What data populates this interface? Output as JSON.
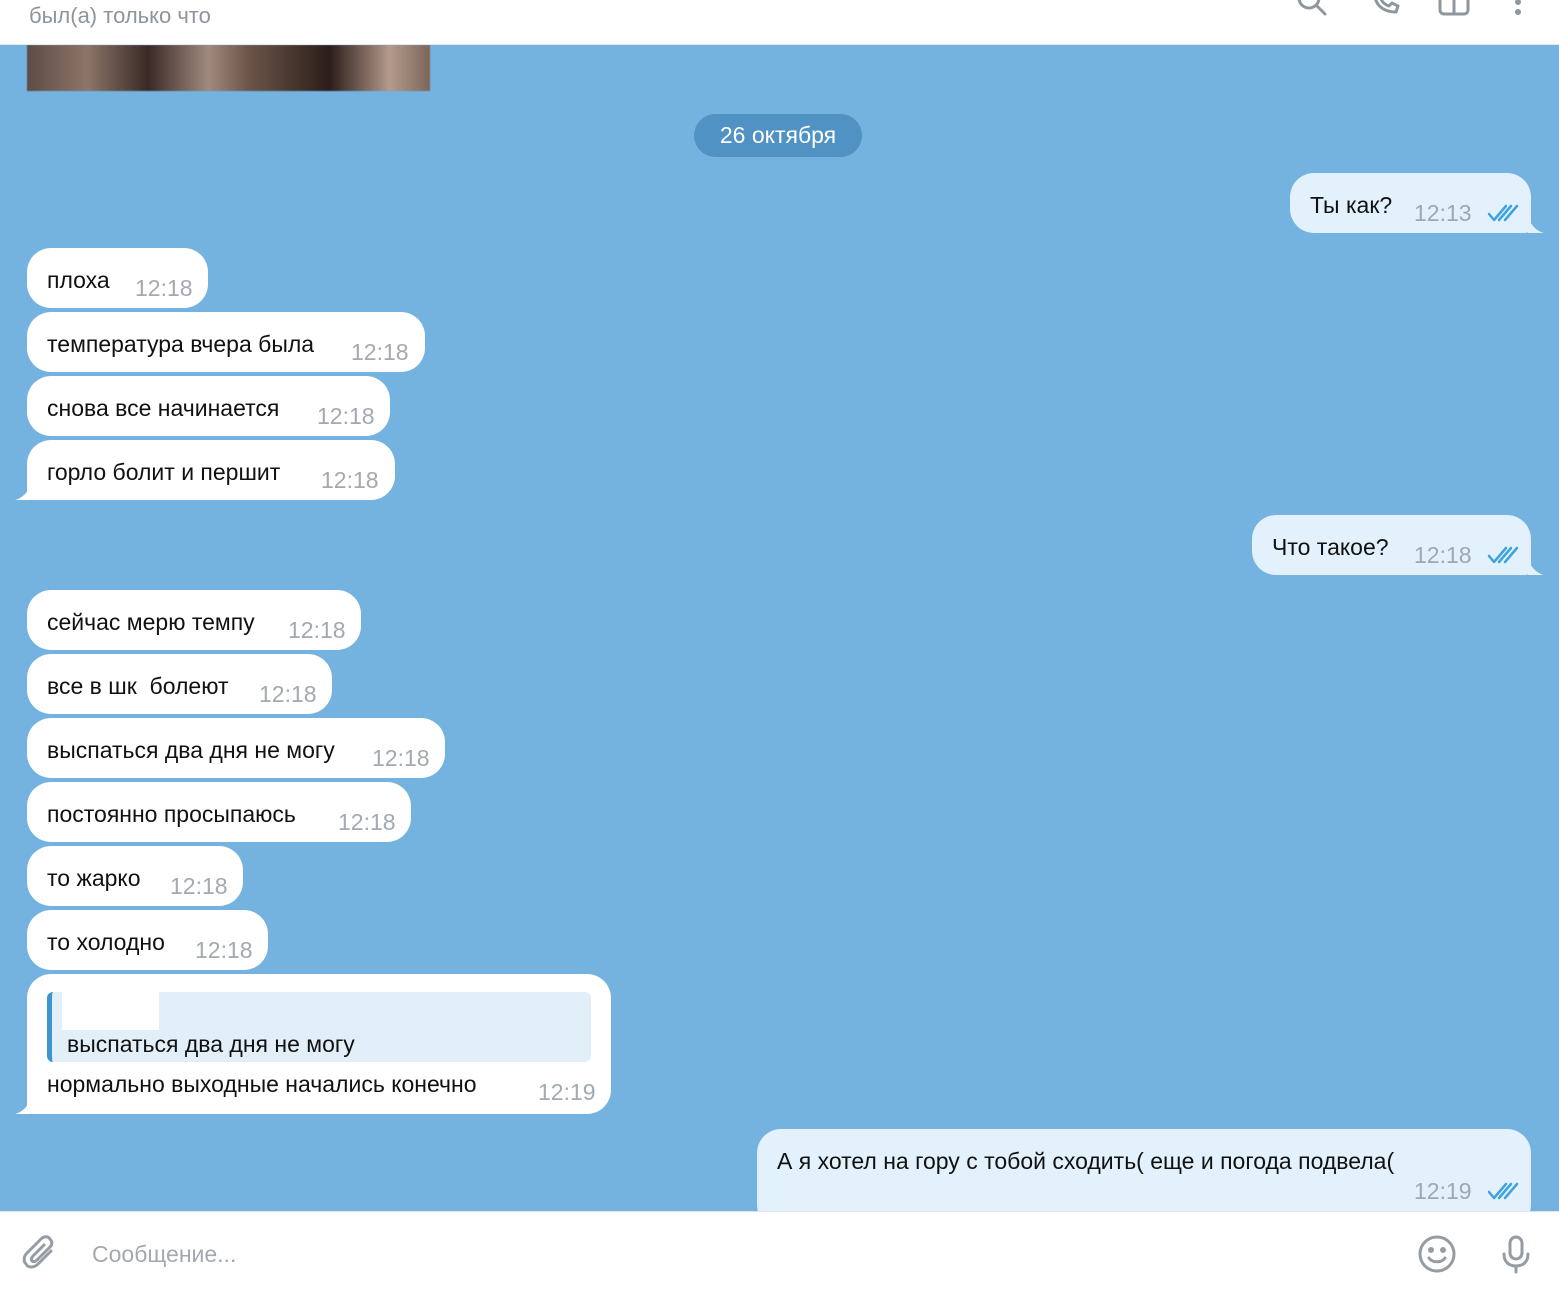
{
  "header": {
    "status": "был(а) только что",
    "icons": [
      "search-icon",
      "phone-icon",
      "layout-icon",
      "more-vert-icon"
    ]
  },
  "chat": {
    "date_separator": "26 октября",
    "messages": [
      {
        "dir": "out",
        "text": "Ты как?",
        "time": "12:13",
        "read": true
      },
      {
        "dir": "in",
        "text": "плоха",
        "time": "12:18"
      },
      {
        "dir": "in",
        "text": "температура вчера была",
        "time": "12:18"
      },
      {
        "dir": "in",
        "text": "снова все начинается",
        "time": "12:18"
      },
      {
        "dir": "in",
        "text": "горло болит и першит",
        "time": "12:18"
      },
      {
        "dir": "out",
        "text": "Что такое?",
        "time": "12:18",
        "read": true
      },
      {
        "dir": "in",
        "text": "сейчас мерю темпу",
        "time": "12:18"
      },
      {
        "dir": "in",
        "text": "все в шк  болеют",
        "time": "12:18"
      },
      {
        "dir": "in",
        "text": "выспаться два дня не могу",
        "time": "12:18"
      },
      {
        "dir": "in",
        "text": "постоянно просыпаюсь",
        "time": "12:18"
      },
      {
        "dir": "in",
        "text": "то жарко",
        "time": "12:18"
      },
      {
        "dir": "in",
        "text": "то холодно",
        "time": "12:18"
      },
      {
        "dir": "in",
        "reply_to": "выспаться два дня не могу",
        "text": "нормально выходные начались конечно",
        "time": "12:19"
      },
      {
        "dir": "out",
        "text": "А я хотел на гору с тобой сходить( еще и погода подвела(",
        "time": "12:19",
        "read": true
      }
    ]
  },
  "composer": {
    "placeholder": "Сообщение...",
    "value": ""
  },
  "colors": {
    "chat_background": "#74b2df",
    "outgoing_bubble": "#e2f1fb",
    "incoming_bubble": "#ffffff",
    "date_pill": "#4f92c3",
    "read_check": "#3ea3e0",
    "reply_accent": "#3c95cf"
  }
}
